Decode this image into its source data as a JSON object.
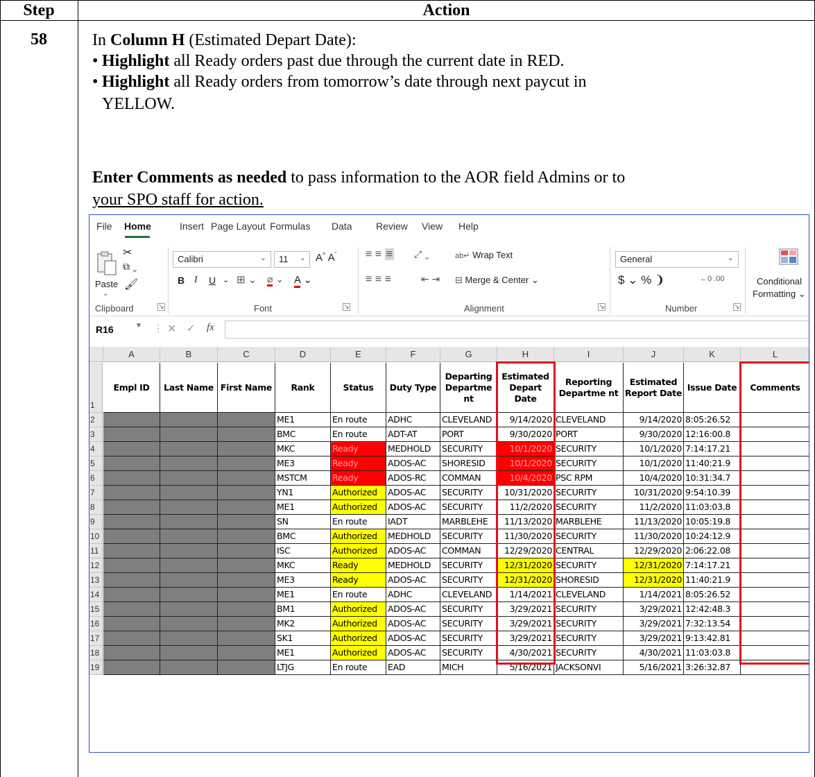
{
  "table": {
    "header_step": "Step",
    "header_action": "Action",
    "step_number": "58"
  },
  "instructions": {
    "line1_prefix": "In ",
    "line1_bold": "Column H",
    "line1_suffix": " (Estimated Depart Date):",
    "bullet1_bold": "Highlight",
    "bullet1_text": " all Ready orders past due through the current date in RED.",
    "bullet2_bold": "Highlight",
    "bullet2_text": " all Ready orders from tomorrow’s date through next paycut in",
    "bullet2_text_cont": "YELLOW.",
    "comments_bold": "Enter Comments as needed",
    "comments_text": " to pass information to the AOR field Admins or to",
    "comments_text_cont": "your SPO staff for action."
  },
  "excel": {
    "menu_tabs": [
      "File",
      "Home",
      "Insert",
      "Page Layout",
      "Formulas",
      "Data",
      "Review",
      "View",
      "Help"
    ],
    "active_tab": "Home",
    "ribbon": {
      "paste_label": "Paste",
      "font_name": "Calibri",
      "font_size": "11",
      "wrap_text_label": "Wrap Text",
      "merge_center_label": "Merge & Center",
      "number_format": "General",
      "conditional_label_1": "Conditional",
      "conditional_label_2": "Formatting",
      "groups": [
        "Clipboard",
        "Font",
        "Alignment",
        "Number"
      ]
    },
    "name_box": "R16",
    "fx_label": "fx",
    "column_letters": [
      "A",
      "B",
      "C",
      "D",
      "E",
      "F",
      "G",
      "H",
      "I",
      "J",
      "K",
      "L"
    ],
    "header_rownum": "1",
    "headers": [
      "Empl ID",
      "Last Name",
      "First Name",
      "Rank",
      "Status",
      "Duty Type",
      "Departing Departme nt",
      "Estimated Depart Date",
      "Reporting Departme nt",
      "Estimated Report Date",
      "Issue Date",
      "Comments"
    ],
    "rows": [
      {
        "n": "2",
        "rank": "ME1",
        "status": "En route",
        "duty": "ADHC",
        "dep": "CLEVELAND",
        "edd": "9/14/2020",
        "rep": "CLEVELAND",
        "erd": "9/14/2020",
        "issue": "8:05:26.52",
        "status_hl": "none",
        "edd_hl": "none",
        "erd_hl": "none"
      },
      {
        "n": "3",
        "rank": "BMC",
        "status": "En route",
        "duty": "ADT-AT",
        "dep": "PORT",
        "edd": "9/30/2020",
        "rep": "PORT",
        "erd": "9/30/2020",
        "issue": "12:16:00.8",
        "status_hl": "none",
        "edd_hl": "none",
        "erd_hl": "none"
      },
      {
        "n": "4",
        "rank": "MKC",
        "status": "Ready",
        "duty": "MEDHOLD",
        "dep": "SECURITY",
        "edd": "10/1/2020",
        "rep": "SECURITY",
        "erd": "10/1/2020",
        "issue": "7:14:17.21",
        "status_hl": "red",
        "edd_hl": "red",
        "erd_hl": "none"
      },
      {
        "n": "5",
        "rank": "ME3",
        "status": "Ready",
        "duty": "ADOS-AC",
        "dep": "SHORESID",
        "edd": "10/1/2020",
        "rep": "SECURITY",
        "erd": "10/1/2020",
        "issue": "11:40:21.9",
        "status_hl": "red",
        "edd_hl": "red",
        "erd_hl": "none"
      },
      {
        "n": "6",
        "rank": "MSTCM",
        "status": "Ready",
        "duty": "ADOS-RC",
        "dep": "COMMAN",
        "edd": "10/4/2020",
        "rep": "PSC RPM",
        "erd": "10/4/2020",
        "issue": "10:31:34.7",
        "status_hl": "red",
        "edd_hl": "red",
        "erd_hl": "none"
      },
      {
        "n": "7",
        "rank": "YN1",
        "status": "Authorized",
        "duty": "ADOS-AC",
        "dep": "SECURITY",
        "edd": "10/31/2020",
        "rep": "SECURITY",
        "erd": "10/31/2020",
        "issue": "9:54:10.39",
        "status_hl": "yellow",
        "edd_hl": "none",
        "erd_hl": "none"
      },
      {
        "n": "8",
        "rank": "ME1",
        "status": "Authorized",
        "duty": "ADOS-AC",
        "dep": "SECURITY",
        "edd": "11/2/2020",
        "rep": "SECURITY",
        "erd": "11/2/2020",
        "issue": "11:03:03.8",
        "status_hl": "yellow",
        "edd_hl": "none",
        "erd_hl": "none"
      },
      {
        "n": "9",
        "rank": "SN",
        "status": "En route",
        "duty": "IADT",
        "dep": "MARBLEHE",
        "edd": "11/13/2020",
        "rep": "MARBLEHE",
        "erd": "11/13/2020",
        "issue": "10:05:19.8",
        "status_hl": "none",
        "edd_hl": "none",
        "erd_hl": "none"
      },
      {
        "n": "10",
        "rank": "BMC",
        "status": "Authorized",
        "duty": "MEDHOLD",
        "dep": "SECURITY",
        "edd": "11/30/2020",
        "rep": "SECURITY",
        "erd": "11/30/2020",
        "issue": "10:24:12.9",
        "status_hl": "yellow",
        "edd_hl": "none",
        "erd_hl": "none"
      },
      {
        "n": "11",
        "rank": "ISC",
        "status": "Authorized",
        "duty": "ADOS-AC",
        "dep": "COMMAN",
        "edd": "12/29/2020",
        "rep": "CENTRAL",
        "erd": "12/29/2020",
        "issue": "2:06:22.08",
        "status_hl": "yellow",
        "edd_hl": "none",
        "erd_hl": "none"
      },
      {
        "n": "12",
        "rank": "MKC",
        "status": "Ready",
        "duty": "MEDHOLD",
        "dep": "SECURITY",
        "edd": "12/31/2020",
        "rep": "SECURITY",
        "erd": "12/31/2020",
        "issue": "7:14:17.21",
        "status_hl": "yellow",
        "edd_hl": "yellow",
        "erd_hl": "yellow"
      },
      {
        "n": "13",
        "rank": "ME3",
        "status": "Ready",
        "duty": "ADOS-AC",
        "dep": "SECURITY",
        "edd": "12/31/2020",
        "rep": "SHORESID",
        "erd": "12/31/2020",
        "issue": "11:40:21.9",
        "status_hl": "yellow",
        "edd_hl": "yellow",
        "erd_hl": "yellow"
      },
      {
        "n": "14",
        "rank": "ME1",
        "status": "En route",
        "duty": "ADHC",
        "dep": "CLEVELAND",
        "edd": "1/14/2021",
        "rep": "CLEVELAND",
        "erd": "1/14/2021",
        "issue": "8:05:26.52",
        "status_hl": "none",
        "edd_hl": "none",
        "erd_hl": "none"
      },
      {
        "n": "15",
        "rank": "BM1",
        "status": "Authorized",
        "duty": "ADOS-AC",
        "dep": "SECURITY",
        "edd": "3/29/2021",
        "rep": "SECURITY",
        "erd": "3/29/2021",
        "issue": "12:42:48.3",
        "status_hl": "yellow",
        "edd_hl": "none",
        "erd_hl": "none"
      },
      {
        "n": "16",
        "rank": "MK2",
        "status": "Authorized",
        "duty": "ADOS-AC",
        "dep": "SECURITY",
        "edd": "3/29/2021",
        "rep": "SECURITY",
        "erd": "3/29/2021",
        "issue": "7:32:13.54",
        "status_hl": "yellow",
        "edd_hl": "none",
        "erd_hl": "none"
      },
      {
        "n": "17",
        "rank": "SK1",
        "status": "Authorized",
        "duty": "ADOS-AC",
        "dep": "SECURITY",
        "edd": "3/29/2021",
        "rep": "SECURITY",
        "erd": "3/29/2021",
        "issue": "9:13:42.81",
        "status_hl": "yellow",
        "edd_hl": "none",
        "erd_hl": "none"
      },
      {
        "n": "18",
        "rank": "ME1",
        "status": "Authorized",
        "duty": "ADOS-AC",
        "dep": "SECURITY",
        "edd": "4/30/2021",
        "rep": "SECURITY",
        "erd": "4/30/2021",
        "issue": "11:03:03.8",
        "status_hl": "yellow",
        "edd_hl": "none",
        "erd_hl": "none"
      },
      {
        "n": "19",
        "rank": "LTJG",
        "status": "En route",
        "duty": "EAD",
        "dep": "MICH",
        "edd": "5/16/2021",
        "rep": "JACKSONVI",
        "erd": "5/16/2021",
        "issue": "3:26:32.87",
        "status_hl": "none",
        "edd_hl": "none",
        "erd_hl": "none"
      }
    ],
    "colors": {
      "red": "#ff0000",
      "yellow": "#ffff00",
      "redacted": "#7f7f7f",
      "callout": "#e0101e",
      "excel_green": "#217346"
    }
  }
}
